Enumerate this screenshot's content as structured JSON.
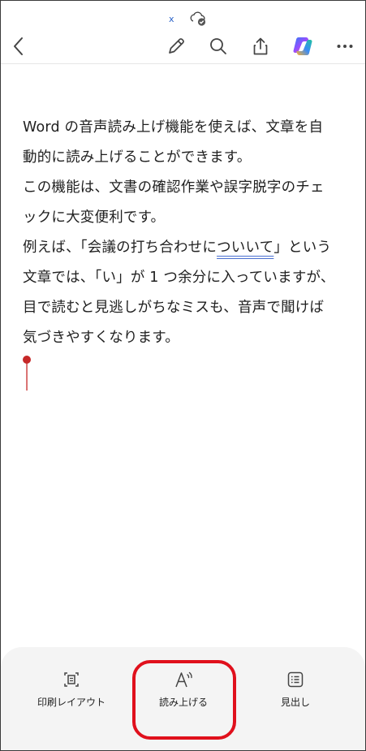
{
  "status": {
    "doc_marker": "x"
  },
  "toolbar": {
    "back_icon": "chevron-left-icon",
    "edit_icon": "pencil-icon",
    "search_icon": "search-icon",
    "share_icon": "share-icon",
    "copilot_icon": "copilot-icon",
    "more_icon": "ellipsis-icon"
  },
  "document": {
    "line1": "Word の音声読み上げ機能を使えば、文章を自",
    "line2": "動的に読み上げることができます。",
    "line3": "この機能は、文書の確認作業や誤字脱字のチェ",
    "line4": "ックに大変便利です。",
    "line5_before": "例えば、「会議の打ち合わせに",
    "line5_flagged": "ついいて",
    "line5_after": "」という",
    "line6": "文章では、「い」が 1 つ余分に入っていますが、",
    "line7": "目で読むと見逃しがちなミスも、音声で聞けば",
    "line8": "気づきやすくなります。"
  },
  "bottom_bar": {
    "print_layout_label": "印刷レイアウト",
    "read_aloud_label": "読み上げる",
    "headings_label": "見出し"
  },
  "colors": {
    "accent_red": "#e0101c",
    "cursor_red": "#c62828",
    "spell_underline": "#4a6fd0"
  }
}
